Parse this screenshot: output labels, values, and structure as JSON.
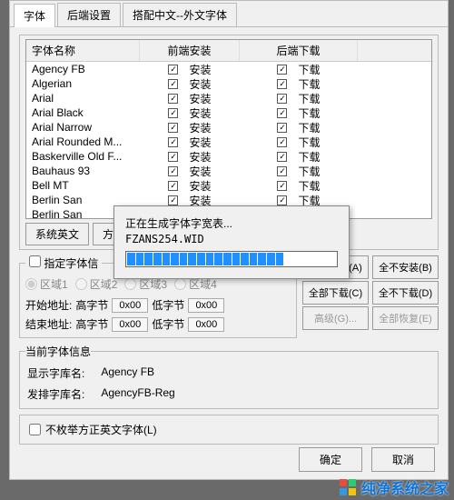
{
  "tabs": {
    "font": "字体",
    "backend": "后端设置",
    "mix": "搭配中文--外文字体"
  },
  "headers": {
    "name": "字体名称",
    "fe": "前端安装",
    "be": "后端下载"
  },
  "labels": {
    "install": "安装",
    "download": "下载"
  },
  "rows": [
    {
      "name": "Agency FB",
      "fe": true,
      "be": true
    },
    {
      "name": "Algerian",
      "fe": true,
      "be": true
    },
    {
      "name": "Arial",
      "fe": true,
      "be": true
    },
    {
      "name": "Arial Black",
      "fe": true,
      "be": true
    },
    {
      "name": "Arial Narrow",
      "fe": true,
      "be": true
    },
    {
      "name": "Arial Rounded M...",
      "fe": true,
      "be": true
    },
    {
      "name": "Baskerville Old F...",
      "fe": true,
      "be": true
    },
    {
      "name": "Bauhaus 93",
      "fe": true,
      "be": true
    },
    {
      "name": "Bell MT",
      "fe": true,
      "be": true
    },
    {
      "name": "Berlin San",
      "fe": true,
      "be": true
    },
    {
      "name": "Berlin San",
      "fe": true,
      "be": true
    }
  ],
  "small_btns": {
    "sys_en": "系统英文",
    "fzheng": "方正"
  },
  "addr": {
    "legend": "指定字体信",
    "radios": [
      "区域1",
      "区域2",
      "区域3",
      "区域4"
    ],
    "start": "开始地址:",
    "end": "结束地址:",
    "hi": "高字节",
    "lo": "低字节",
    "val": "0x00"
  },
  "right_btns": {
    "all_install": "全部安装(A)",
    "none_install": "全不安装(B)",
    "all_download": "全部下载(C)",
    "none_download": "全不下载(D)",
    "advanced": "高级(G)...",
    "restore": "全部恢复(E)"
  },
  "info": {
    "legend": "当前字体信息",
    "display_label": "显示字库名:",
    "display_value": "Agency FB",
    "layout_label": "发排字库名:",
    "layout_value": "AgencyFB-Reg"
  },
  "checkbox_line": "不枚举方正英文字体(L)",
  "ok": "确定",
  "cancel": "取消",
  "progress": {
    "msg": "正在生成字体字宽表...",
    "file": "FZANS254.WID",
    "filled": 18,
    "total": 24
  },
  "watermark": "纯净系统之家"
}
